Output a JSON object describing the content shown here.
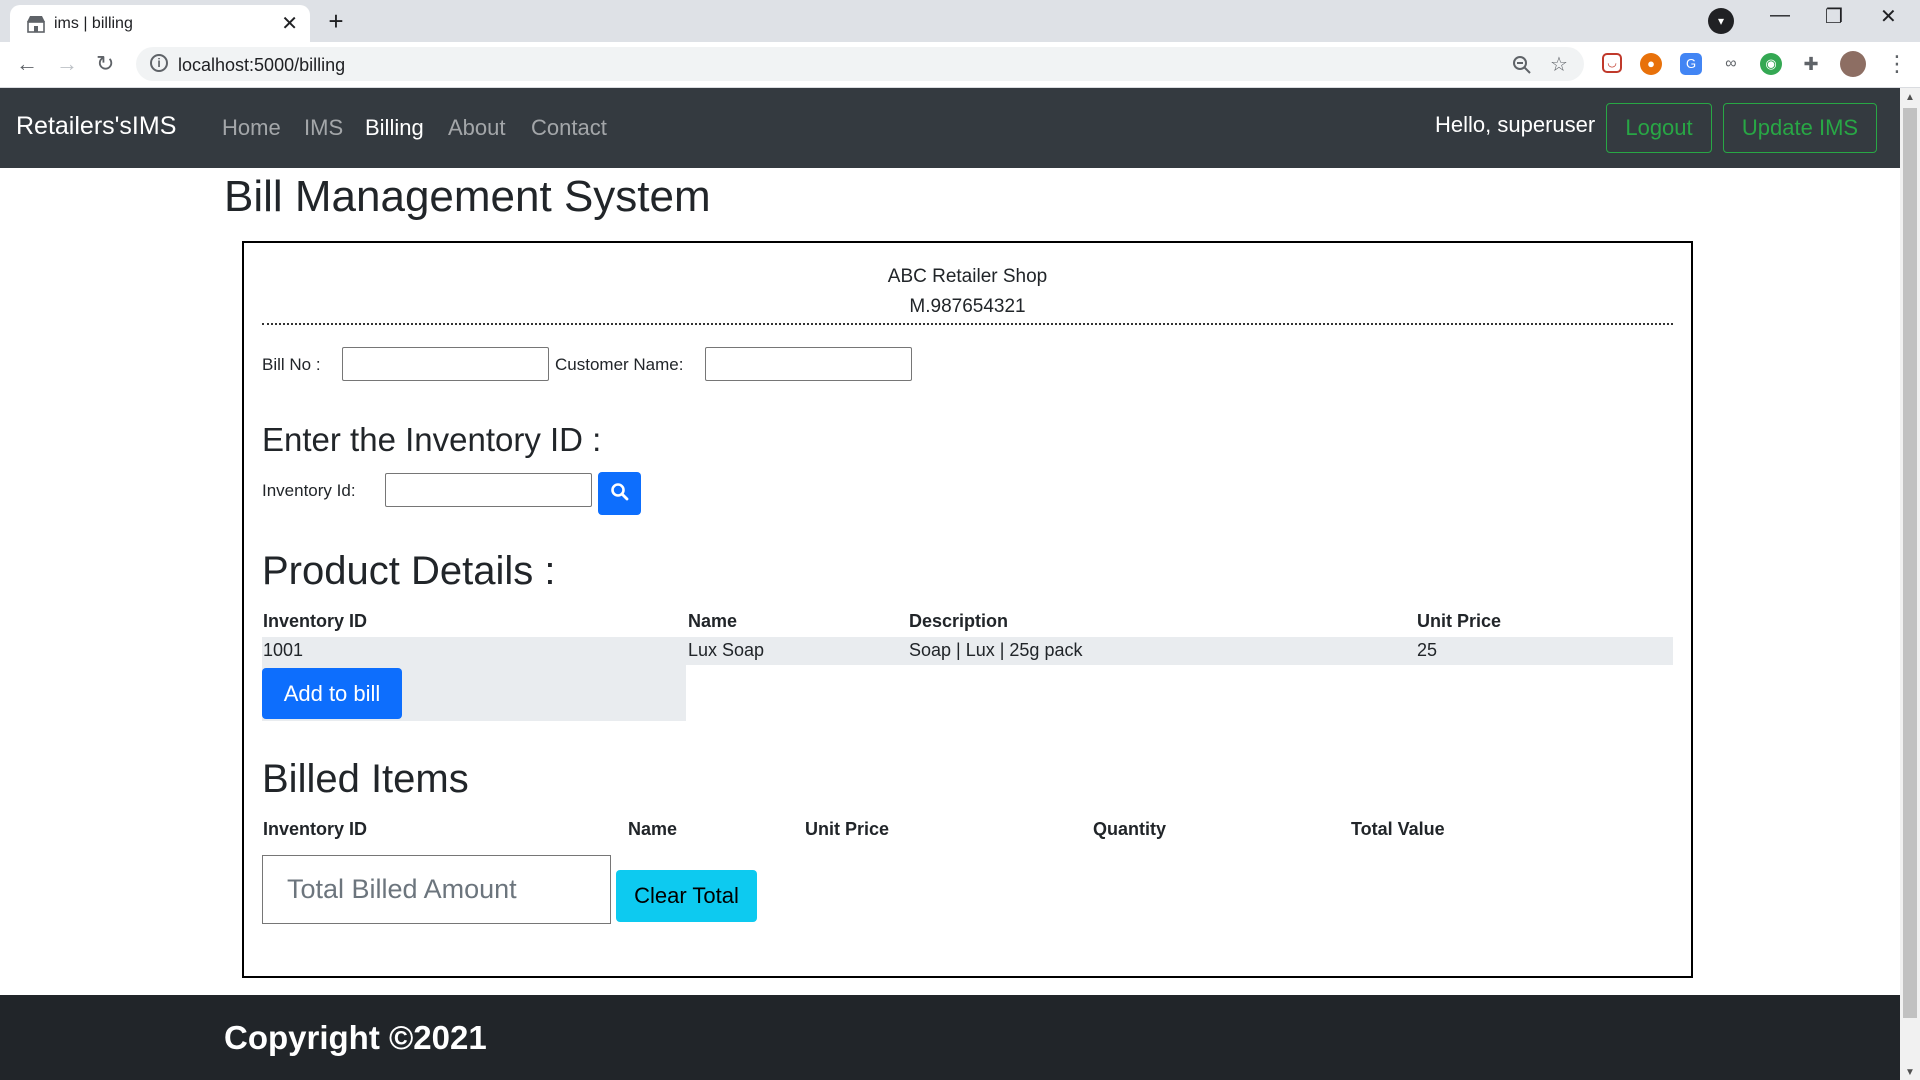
{
  "browser": {
    "tab_title": "ims | billing",
    "url": "localhost:5000/billing"
  },
  "navbar": {
    "brand": "Retailers'sIMS",
    "links": [
      "Home",
      "IMS",
      "Billing",
      "About",
      "Contact"
    ],
    "active_link": "Billing",
    "greeting": "Hello, superuser",
    "logout_label": "Logout",
    "update_label": "Update IMS",
    "accent_color": "#28a745"
  },
  "page": {
    "title": "Bill Management System"
  },
  "bill": {
    "shop_name": "ABC Retailer Shop",
    "shop_phone": "M.987654321",
    "bill_no_label": "Bill No :",
    "bill_no_value": "",
    "customer_label": "Customer Name:",
    "customer_value": "",
    "inventory_heading": "Enter the Inventory ID :",
    "inventory_label": "Inventory Id:",
    "inventory_value": "",
    "search_icon": "search-icon"
  },
  "product_details": {
    "heading": "Product Details :",
    "columns": [
      "Inventory ID",
      "Name",
      "Description",
      "Unit Price"
    ],
    "row": [
      "1001",
      "Lux Soap",
      "Soap | Lux | 25g pack",
      "25"
    ],
    "add_button": "Add to bill"
  },
  "billed_items": {
    "heading": "Billed Items",
    "columns": [
      "Inventory ID",
      "Name",
      "Unit Price",
      "Quantity",
      "Total Value"
    ],
    "total_placeholder": "Total Billed Amount",
    "clear_button": "Clear Total"
  },
  "footer": {
    "copyright": "Copyright ©2021"
  }
}
